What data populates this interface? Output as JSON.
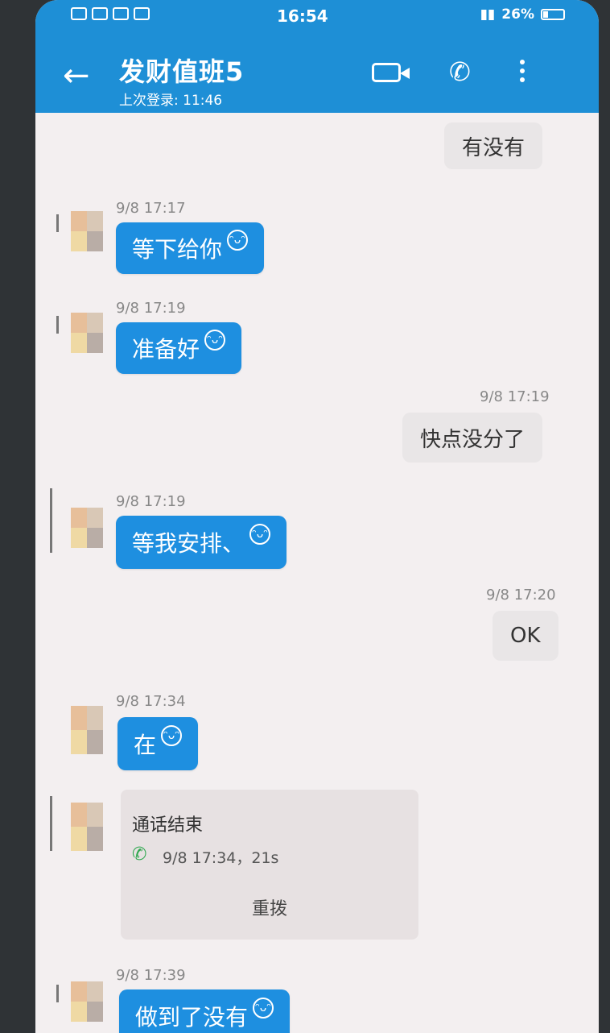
{
  "status_bar": {
    "time": "16:54",
    "battery": "26%"
  },
  "header": {
    "title": "发财值班5",
    "subtitle": "上次登录: 11:46"
  },
  "messages": [
    {
      "dir": "out",
      "text": "有没有"
    },
    {
      "dir": "in",
      "time": "9/8 17:17",
      "text": "等下给你"
    },
    {
      "dir": "in",
      "time": "9/8 17:19",
      "text": "准备好"
    },
    {
      "dir": "out",
      "time": "9/8 17:19",
      "text": "快点没分了"
    },
    {
      "dir": "in",
      "time": "9/8 17:19",
      "text": "等我安排、"
    },
    {
      "dir": "out",
      "time": "9/8 17:20",
      "text": "OK"
    },
    {
      "dir": "in",
      "time": "9/8 17:34",
      "text": "在"
    },
    {
      "dir": "in",
      "type": "call",
      "title": "通话结束",
      "meta": "9/8 17:34，21s",
      "action": "重拨"
    },
    {
      "dir": "in",
      "time": "9/8 17:39",
      "text": "做到了没有"
    }
  ]
}
